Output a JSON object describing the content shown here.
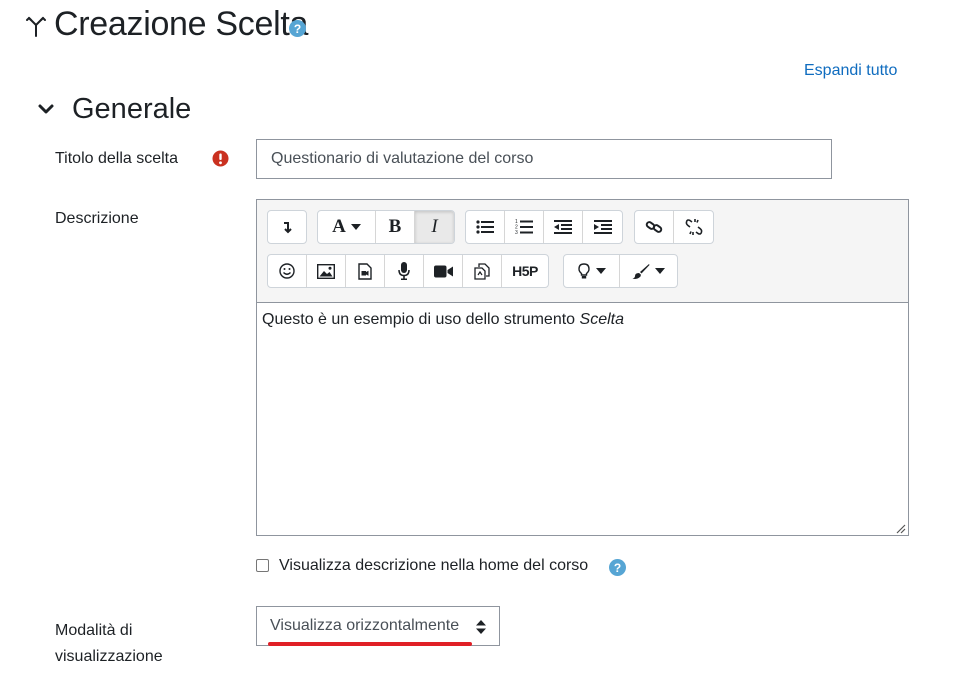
{
  "header": {
    "title": "Creazione Scelta",
    "module_icon": "choice-icon",
    "help_icon": "help-icon",
    "expand_all": "Espandi tutto"
  },
  "section": {
    "title": "Generale",
    "toggle_icon": "chevron-down-icon"
  },
  "fields": {
    "title": {
      "label": "Titolo della scelta",
      "required_icon": "required-icon",
      "value": "Questionario di valutazione del corso"
    },
    "description": {
      "label": "Descrizione",
      "content_prefix": "Questo è un esempio di uso dello strumento ",
      "content_italic": "Scelta",
      "toolbar_row1": [
        "toggle-toolbar",
        "font-style-dropdown",
        "bold",
        "italic",
        "bullet-list",
        "numbered-list",
        "outdent",
        "indent",
        "link",
        "unlink"
      ],
      "toolbar_row2": [
        "emoji",
        "image",
        "media",
        "record-audio",
        "record-video",
        "manage-files",
        "h5p",
        "accessibility-checker",
        "text-color"
      ],
      "h5p_label": "H5P",
      "font_label": "A",
      "bold_label": "B",
      "italic_label": "I"
    },
    "show_description": {
      "label": "Visualizza descrizione nella home del corso",
      "checked": false
    },
    "display_mode": {
      "label": "Modalità di visualizzazione",
      "selected": "Visualizza orizzontalmente"
    }
  },
  "colors": {
    "link": "#0f6cbf",
    "required": "#ca3120",
    "help": "#56a5d4",
    "underline": "#e01f26"
  }
}
